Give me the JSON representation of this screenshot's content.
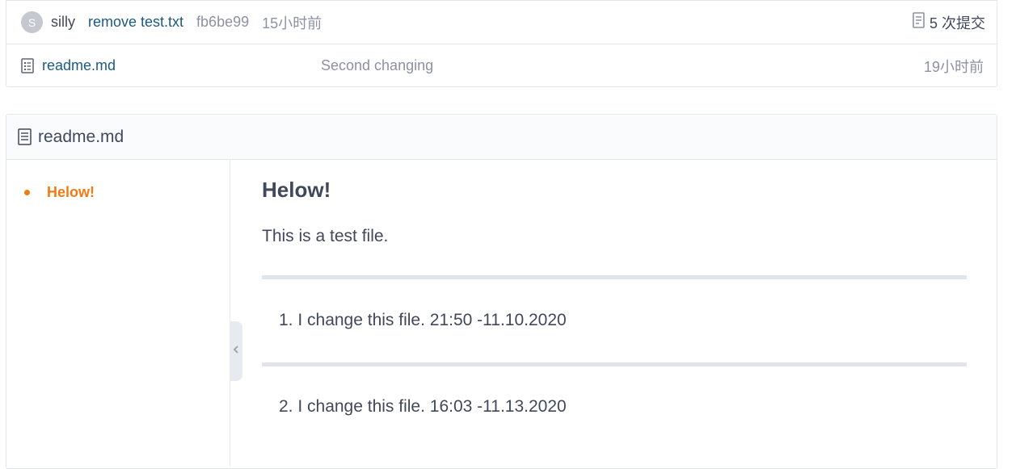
{
  "commit": {
    "avatar_letter": "S",
    "author": "silly",
    "message": "remove test.txt",
    "sha": "fb6be99",
    "time": "15小时前",
    "count_label": "5 次提交"
  },
  "files": [
    {
      "name": "readme.md",
      "commit_message": "Second changing",
      "time": "19小时前"
    }
  ],
  "readme": {
    "title": "readme.md",
    "toc": [
      {
        "label": "Helow!"
      }
    ],
    "heading": "Helow!",
    "paragraph": "This is a test file.",
    "list_items": [
      "1. I change this file. 21:50 -11.10.2020",
      "2. I change this file. 16:03 -11.13.2020"
    ]
  },
  "colors": {
    "link": "#1b5a83",
    "muted": "#8c92a4",
    "toc_accent": "#f07b12",
    "text": "#40485b",
    "border": "#e3e6ea"
  },
  "icons": {
    "file": "file-text-icon",
    "commit_count": "file-history-icon",
    "collapse": "chevron-left-icon"
  }
}
